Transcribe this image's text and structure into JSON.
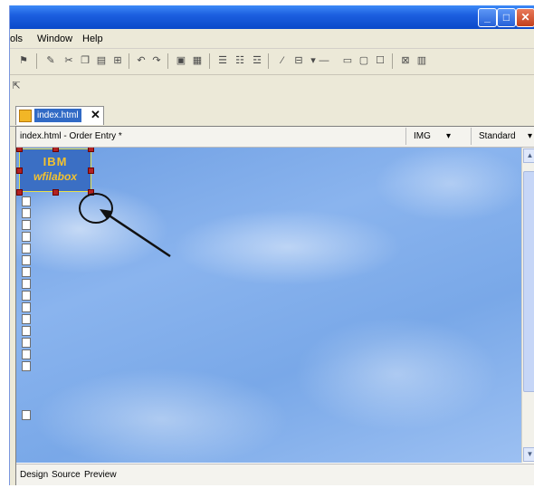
{
  "window": {
    "title": ""
  },
  "menubar": {
    "items": [
      "ols",
      "Window",
      "Help"
    ]
  },
  "toolbar": {
    "icons": [
      "bug-icon",
      "pen-icon",
      "cut-icon",
      "copy-icon",
      "paste-icon",
      "grid-icon",
      "undo-icon",
      "redo-icon",
      "frame-icon",
      "image-icon",
      "list-icon",
      "list-numbered-icon",
      "list-indent-icon",
      "link-icon",
      "table-icon",
      "line-icon",
      "form-icon",
      "panel-icon",
      "box-icon",
      "settings-icon",
      "chart-icon"
    ]
  },
  "tabs": [
    {
      "label": "index.html",
      "active": true
    }
  ],
  "editor": {
    "document_title": "index.html - Order Entry *",
    "element_type": "IMG",
    "style_mode": "Standard"
  },
  "canvas": {
    "logo_line1": "IBM",
    "logo_line2": "wfilabox",
    "placeholder_count": 15
  },
  "view_tabs": [
    "Design",
    "Source",
    "Preview"
  ],
  "colors": {
    "titlebar": "#0a49c9",
    "selection": "#316ac5",
    "canvas_sky": "#79a8e8"
  }
}
